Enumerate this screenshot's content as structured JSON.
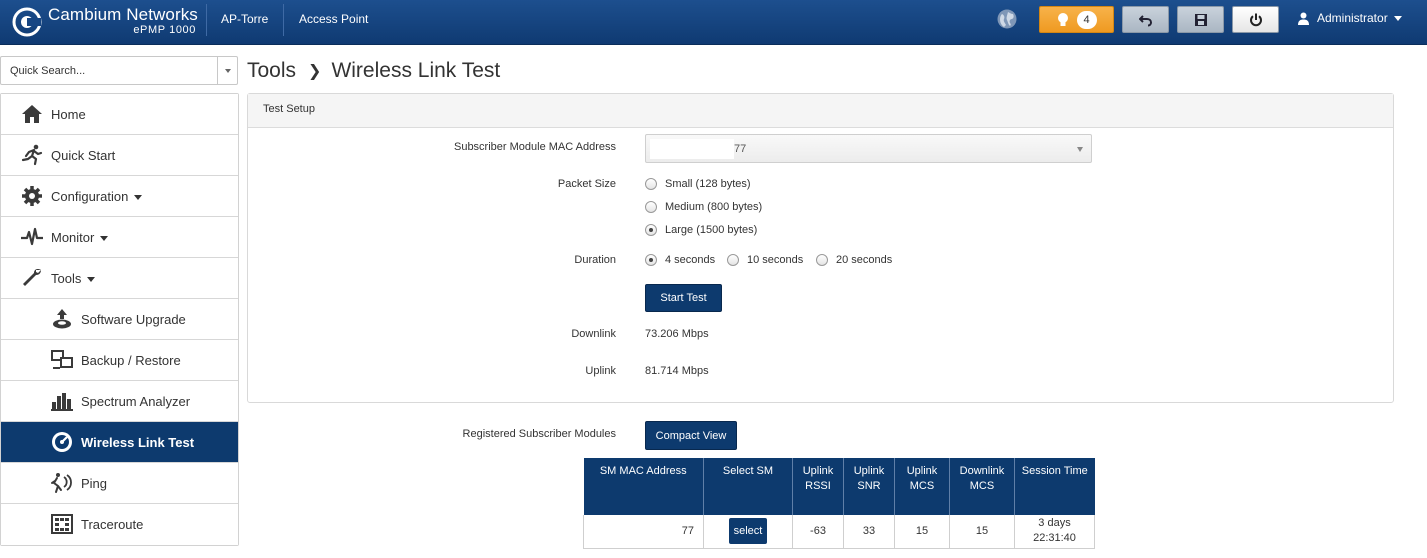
{
  "header": {
    "brand_name": "Cambium Networks",
    "brand_sub": "ePMP 1000",
    "device_name": "AP-Torre",
    "device_mode": "Access Point",
    "alert_count": "4",
    "user": "Administrator",
    "colors": {
      "bar": "#1a4a87",
      "alert": "#f2a32e"
    }
  },
  "sidebar": {
    "search_placeholder": "Quick Search...",
    "items": [
      {
        "label": "Home",
        "icon": "home-icon"
      },
      {
        "label": "Quick Start",
        "icon": "runner-icon"
      },
      {
        "label": "Configuration",
        "icon": "gear-icon"
      },
      {
        "label": "Monitor",
        "icon": "pulse-icon"
      },
      {
        "label": "Tools",
        "icon": "wrench-icon"
      },
      {
        "label": "Software Upgrade",
        "icon": "upgrade-icon"
      },
      {
        "label": "Backup / Restore",
        "icon": "backup-icon"
      },
      {
        "label": "Spectrum Analyzer",
        "icon": "spectrum-icon"
      },
      {
        "label": "Wireless Link Test",
        "icon": "gauge-icon"
      },
      {
        "label": "Ping",
        "icon": "ping-icon"
      },
      {
        "label": "Traceroute",
        "icon": "traceroute-icon"
      }
    ],
    "active_color": "#0d3a6e"
  },
  "page": {
    "section": "Tools",
    "title": "Wireless Link Test"
  },
  "test_setup": {
    "panel_title": "Test Setup",
    "mac_label": "Subscriber Module MAC Address",
    "mac_value": "77",
    "packet_size_label": "Packet Size",
    "packet_sizes": [
      "Small (128 bytes)",
      "Medium (800 bytes)",
      "Large (1500 bytes)"
    ],
    "packet_size_selected": "Large (1500 bytes)",
    "duration_label": "Duration",
    "durations": [
      "4 seconds",
      "10 seconds",
      "20 seconds"
    ],
    "duration_selected": "4 seconds",
    "start_button": "Start Test",
    "downlink_label": "Downlink",
    "downlink_value": "73.206 Mbps",
    "uplink_label": "Uplink",
    "uplink_value": "81.714 Mbps"
  },
  "registered": {
    "label": "Registered Subscriber Modules",
    "compact_button": "Compact View",
    "columns": [
      [
        "SM MAC Address"
      ],
      [
        "Select SM"
      ],
      [
        "Uplink",
        "RSSI"
      ],
      [
        "Uplink",
        "SNR"
      ],
      [
        "Uplink",
        "MCS"
      ],
      [
        "Downlink",
        "MCS"
      ],
      [
        "Session Time"
      ]
    ],
    "rows": [
      {
        "mac": "77",
        "select_label": "select",
        "uplink_rssi": "-63",
        "uplink_snr": "33",
        "uplink_mcs": "15",
        "downlink_mcs": "15",
        "session_time": [
          "3 days",
          "22:31:40"
        ]
      }
    ]
  }
}
